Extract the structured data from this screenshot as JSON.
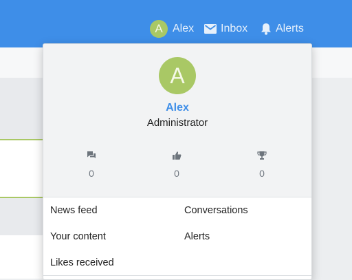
{
  "nav": {
    "user_initial": "A",
    "user_name": "Alex",
    "inbox_label": "Inbox",
    "alerts_label": "Alerts",
    "icons": [
      "envelope-icon",
      "bell-icon"
    ]
  },
  "popup": {
    "avatar_initial": "A",
    "name": "Alex",
    "role": "Administrator",
    "stats": [
      {
        "icon": "messages-icon",
        "value": "0"
      },
      {
        "icon": "thumbs-up-icon",
        "value": "0"
      },
      {
        "icon": "trophy-icon",
        "value": "0"
      }
    ],
    "links": [
      {
        "label": "News feed"
      },
      {
        "label": "Conversations"
      },
      {
        "label": "Your content"
      },
      {
        "label": "Alerts"
      },
      {
        "label": "Likes received"
      }
    ]
  },
  "colors": {
    "header_blue": "#3e8ee8",
    "avatar_green": "#a9c865",
    "name_blue": "#3e8ee8"
  }
}
